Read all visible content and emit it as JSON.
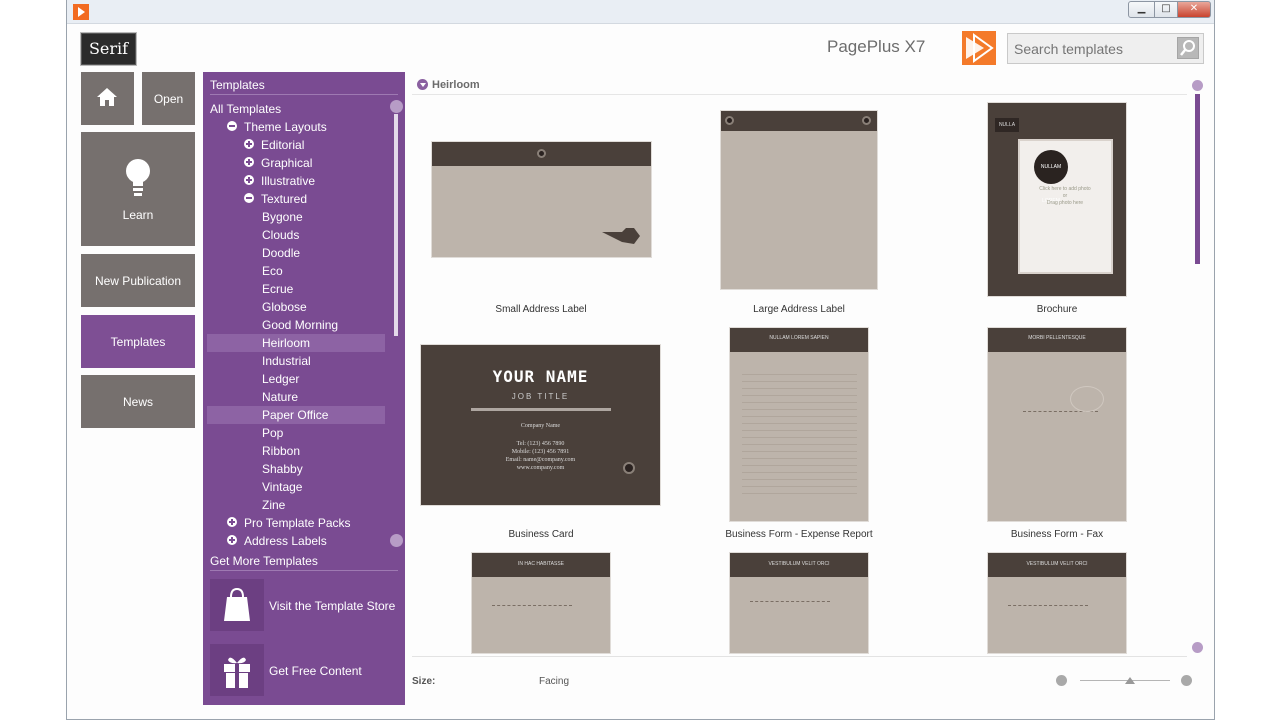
{
  "window": {
    "minimize_icon": "minimize-icon",
    "maximize_icon": "maximize-icon",
    "close_icon": "close-icon"
  },
  "header": {
    "logo": "Serif",
    "product": "PagePlus X7",
    "search_placeholder": "Search templates"
  },
  "nav": {
    "home_icon": "home-icon",
    "open": "Open",
    "learn": "Learn",
    "new_publication": "New Publication",
    "templates": "Templates",
    "news": "News"
  },
  "panel": {
    "title": "Templates",
    "tree": [
      {
        "label": "All Templates",
        "level": 0,
        "toggle": "none"
      },
      {
        "label": "Theme Layouts",
        "level": 1,
        "toggle": "minus"
      },
      {
        "label": "Editorial",
        "level": 2,
        "toggle": "plus"
      },
      {
        "label": "Graphical",
        "level": 2,
        "toggle": "plus"
      },
      {
        "label": "Illustrative",
        "level": 2,
        "toggle": "plus"
      },
      {
        "label": "Textured",
        "level": 2,
        "toggle": "minus"
      },
      {
        "label": "Bygone",
        "level": 3,
        "toggle": "none"
      },
      {
        "label": "Clouds",
        "level": 3,
        "toggle": "none"
      },
      {
        "label": "Doodle",
        "level": 3,
        "toggle": "none"
      },
      {
        "label": "Eco",
        "level": 3,
        "toggle": "none"
      },
      {
        "label": "Ecrue",
        "level": 3,
        "toggle": "none"
      },
      {
        "label": "Globose",
        "level": 3,
        "toggle": "none"
      },
      {
        "label": "Good Morning",
        "level": 3,
        "toggle": "none"
      },
      {
        "label": "Heirloom",
        "level": 3,
        "toggle": "none",
        "selected": true
      },
      {
        "label": "Industrial",
        "level": 3,
        "toggle": "none"
      },
      {
        "label": "Ledger",
        "level": 3,
        "toggle": "none"
      },
      {
        "label": "Nature",
        "level": 3,
        "toggle": "none"
      },
      {
        "label": "Paper Office",
        "level": 3,
        "toggle": "none",
        "hover": true
      },
      {
        "label": "Pop",
        "level": 3,
        "toggle": "none"
      },
      {
        "label": "Ribbon",
        "level": 3,
        "toggle": "none"
      },
      {
        "label": "Shabby",
        "level": 3,
        "toggle": "none"
      },
      {
        "label": "Vintage",
        "level": 3,
        "toggle": "none"
      },
      {
        "label": "Zine",
        "level": 3,
        "toggle": "none"
      },
      {
        "label": "Pro Template Packs",
        "level": 1,
        "toggle": "plus"
      },
      {
        "label": "Address Labels",
        "level": 1,
        "toggle": "plus"
      }
    ],
    "get_more": "Get More Templates",
    "store_link": "Visit the Template Store",
    "free_link": "Get Free Content"
  },
  "content": {
    "group": "Heirloom",
    "templates": [
      {
        "name": "Small Address Label",
        "thumb_text": []
      },
      {
        "name": "Large Address Label",
        "thumb_text": []
      },
      {
        "name": "Brochure",
        "thumb_text": [
          "NULLA",
          "NULLAM LOREM",
          "Click here to add photo",
          "or",
          "Drag photo here"
        ]
      },
      {
        "name": "Business Card",
        "thumb_text": [
          "YOUR NAME",
          "JOB TITLE",
          "Company Name",
          "Tel: (123) 456 7890",
          "Mobile: (123) 456 7891",
          "Email: name@company.com",
          "www.company.com"
        ]
      },
      {
        "name": "Business Form - Expense Report",
        "thumb_text": [
          "NULLAM LOREM SAPIEN"
        ]
      },
      {
        "name": "Business Form - Fax",
        "thumb_text": [
          "MORBI PELLENTESQUE"
        ]
      },
      {
        "name": "",
        "thumb_text": [
          "IN HAC HABITASSE"
        ]
      },
      {
        "name": "",
        "thumb_text": [
          "VESTIBULUM VELIT ORCI"
        ]
      },
      {
        "name": "",
        "thumb_text": [
          "VESTIBULUM VELIT ORCI"
        ]
      }
    ],
    "footer": {
      "size_label": "Size:",
      "size_value": "Facing",
      "zoom_level": 0.55
    }
  },
  "colors": {
    "accent": "#7a4b92",
    "tile": "#76706e",
    "leather": "#4a403a",
    "paper": "#bdb4ab"
  }
}
